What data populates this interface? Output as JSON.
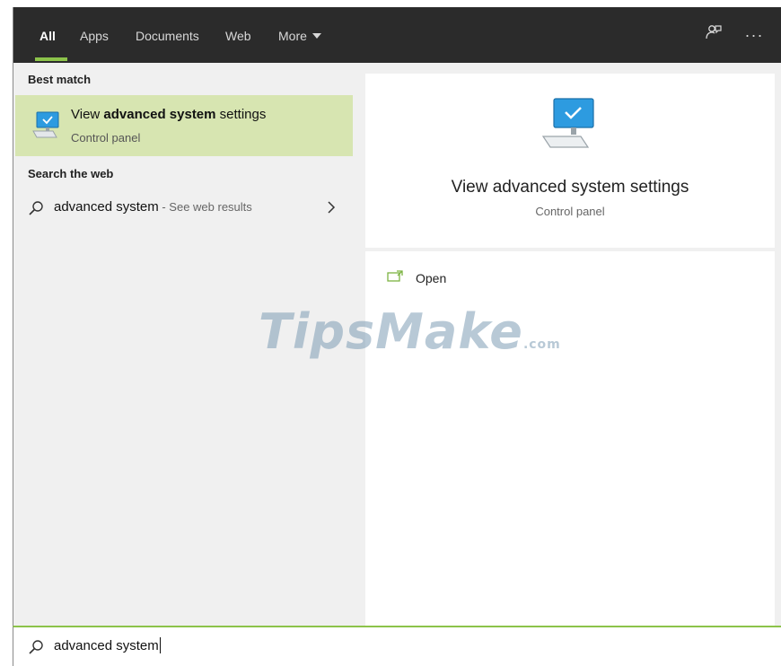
{
  "tabs": [
    {
      "label": "All",
      "active": true
    },
    {
      "label": "Apps"
    },
    {
      "label": "Documents"
    },
    {
      "label": "Web"
    },
    {
      "label": "More"
    }
  ],
  "topbar_icons": [
    "feedback-icon",
    "more-options-icon"
  ],
  "topbar_icon_glyphs": {
    "more": "···"
  },
  "left": {
    "best_match_label": "Best match",
    "best_item": {
      "title_prefix": "View ",
      "title_bold": "advanced system",
      "title_suffix": " settings",
      "subtitle": "Control panel"
    },
    "search_web_label": "Search the web",
    "web_item": {
      "query": "advanced system",
      "suffix": " - See web results"
    }
  },
  "right": {
    "title": "View advanced system settings",
    "subtitle": "Control panel",
    "open_label": "Open"
  },
  "search": {
    "value": "advanced system"
  },
  "watermark": {
    "main": "TipsMake",
    "suffix": ".com"
  },
  "colors": {
    "accent": "#8cc34a",
    "highlight": "#d7e5b1",
    "topbar": "#2b2b2b"
  }
}
